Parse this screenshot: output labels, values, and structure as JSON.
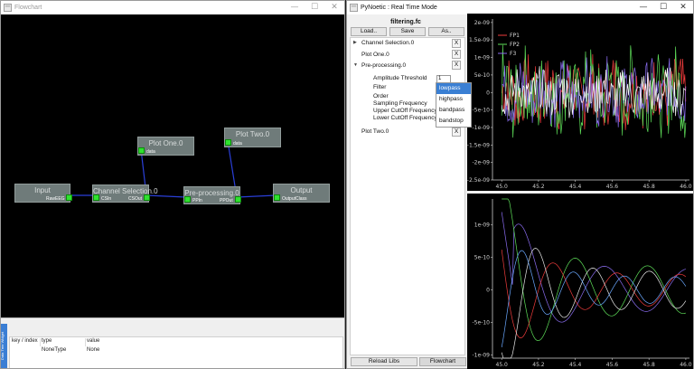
{
  "flowchart_window": {
    "title": "Flowchart",
    "controls": {
      "minimize": "—",
      "maximize": "☐",
      "close": "✕"
    },
    "nodes": [
      {
        "key": "input",
        "title": "Input",
        "terminals": [
          {
            "label": "RawEEG"
          }
        ]
      },
      {
        "key": "channel",
        "title": "Channel Selection.0",
        "terminals": [
          {
            "label": "CSIn"
          },
          {
            "label": "CSOut"
          }
        ]
      },
      {
        "key": "plot1",
        "title": "Plot One.0",
        "terminals": [
          {
            "label": "data"
          }
        ]
      },
      {
        "key": "preproc",
        "title": "Pre-processing.0",
        "terminals": [
          {
            "label": "PPIn"
          },
          {
            "label": "PPOut"
          }
        ]
      },
      {
        "key": "plot2",
        "title": "Plot Two.0",
        "terminals": [
          {
            "label": "data"
          }
        ]
      },
      {
        "key": "output",
        "title": "Output",
        "terminals": [
          {
            "label": "OutputClass"
          }
        ]
      }
    ],
    "dock_label": "Data Tree Widget",
    "data_tree": {
      "headers": [
        "key / index",
        "type",
        "value"
      ],
      "rows": [
        [
          "",
          "NoneType",
          "None"
        ]
      ]
    }
  },
  "pynoetic_window": {
    "title": "PyNoetic : Real Time Mode",
    "controls": {
      "minimize": "—",
      "maximize": "☐",
      "close": "✕"
    },
    "filename": "filtering.fc",
    "buttons": {
      "load": "Load..",
      "save": "Save",
      "save_as": "As..",
      "reload_libs": "Reload Libs",
      "flowchart": "Flowchart"
    },
    "tree": {
      "channel_selection": "Channel Selection.0",
      "plot_one": "Plot One.0",
      "preprocessing": "Pre-processing.0",
      "plot_two": "Plot Two.0",
      "remove_label": "X",
      "params": [
        "Amplitude Threshold",
        "Filter",
        "Order",
        "Sampling Frequency",
        "Upper CutOff Frequency",
        "Lower CutOff Frequency"
      ],
      "threshold_value": "1"
    },
    "filter_dropdown": {
      "options": [
        "lowpass",
        "highpass",
        "bandpass",
        "bandstop"
      ],
      "selected": "lowpass"
    }
  },
  "colors": {
    "accent": "#3a7fd3",
    "terminal": "#2fe22f",
    "node": "#6f7b7a",
    "ch1": "#f03c3c",
    "ch2": "#5fe05a",
    "ch3": "#8a6cf0"
  },
  "chart_data": [
    {
      "type": "line",
      "x": [
        45.0,
        45.2,
        45.4,
        45.6,
        45.8,
        46.0
      ],
      "xlim": [
        44.95,
        46.02
      ],
      "ylim": [
        -2.5e-09,
        2.1e-09
      ],
      "ytick_labels": [
        "2e-09",
        "1.5e-09",
        "1e-09",
        "5e-10",
        "0",
        "-5e-10",
        "-1e-09",
        "-1.5e-09",
        "-2e-09",
        "-2.5e-09"
      ],
      "ytick_values": [
        2e-09,
        1.5e-09,
        1e-09,
        5e-10,
        0,
        -5e-10,
        -1e-09,
        -1.5e-09,
        -2e-09,
        -2.5e-09
      ],
      "xtick_labels": [
        "45.0",
        "45.2",
        "45.4",
        "45.6",
        "45.8",
        "46.0"
      ],
      "legend_position": "top-left",
      "series": [
        {
          "name": "FP1",
          "color": "#f03c3c",
          "amplitude": 9e-10,
          "noisy": true
        },
        {
          "name": "FP2",
          "color": "#5fe05a",
          "amplitude": 1.1e-09,
          "noisy": true
        },
        {
          "name": "F3",
          "color": "#8a6cf0",
          "amplitude": 8e-10,
          "noisy": true
        },
        {
          "name": "",
          "color": "#ffffff",
          "amplitude": 6e-10,
          "noisy": true
        }
      ]
    },
    {
      "type": "line",
      "x": [
        45.0,
        45.2,
        45.4,
        45.6,
        45.8,
        46.0
      ],
      "xlim": [
        44.95,
        46.02
      ],
      "ylim": [
        -1.05e-09,
        1.4e-09
      ],
      "ytick_labels": [
        "1e-09",
        "5e-10",
        "0",
        "-5e-10",
        "-1e-09"
      ],
      "ytick_values": [
        1e-09,
        5e-10,
        0,
        -5e-10,
        -1e-09
      ],
      "xtick_labels": [
        "45.0",
        "45.2",
        "45.4",
        "45.6",
        "45.8",
        "46.0"
      ],
      "series": [
        {
          "name": "",
          "color": "#8a6cf0",
          "amplitude": 4e-10,
          "noisy": false
        },
        {
          "name": "",
          "color": "#5fe05a",
          "amplitude": 4.5e-10,
          "noisy": false
        },
        {
          "name": "",
          "color": "#f03c3c",
          "amplitude": 3e-10,
          "noisy": false
        },
        {
          "name": "",
          "color": "#e8e8e8",
          "amplitude": 3.5e-10,
          "noisy": false
        },
        {
          "name": "",
          "color": "#6aa8ff",
          "amplitude": 2.5e-10,
          "noisy": false
        }
      ]
    }
  ]
}
